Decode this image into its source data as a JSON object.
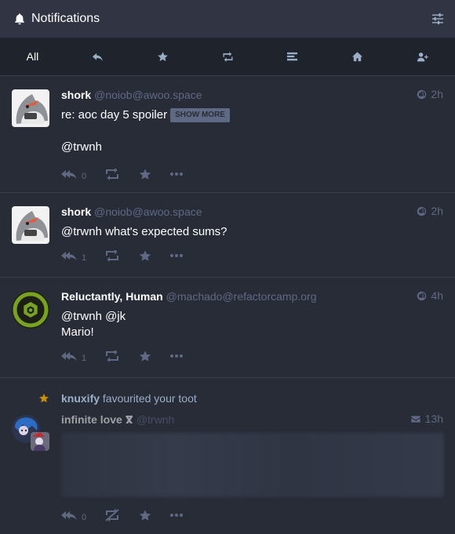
{
  "header": {
    "title": "Notifications",
    "icon": "bell-icon",
    "settings_icon": "sliders-icon"
  },
  "filters": [
    {
      "label": "All",
      "icon": null,
      "active": true
    },
    {
      "label": "",
      "icon": "reply-icon"
    },
    {
      "label": "",
      "icon": "star-icon"
    },
    {
      "label": "",
      "icon": "boost-icon"
    },
    {
      "label": "",
      "icon": "poll-icon"
    },
    {
      "label": "",
      "icon": "home-icon"
    },
    {
      "label": "",
      "icon": "follow-icon"
    }
  ],
  "statuses": [
    {
      "name": "shork",
      "acct": "@noiob@awoo.space",
      "time": "2h",
      "content_line1": "re: aoc day 5 spoiler",
      "show_more": "SHOW MORE",
      "content_line2": "@trwnh",
      "replies": "0"
    },
    {
      "name": "shork",
      "acct": "@noiob@awoo.space",
      "time": "2h",
      "content_line1": "@trwnh what's expected sums?",
      "replies": "1"
    },
    {
      "name": "Reluctantly, Human",
      "acct": "@machado@refactorcamp.org",
      "time": "4h",
      "content_line1": "@trwnh @jk",
      "content_line2": "Mario!",
      "replies": "1"
    }
  ],
  "favourite_notification": {
    "actor": "knuxify",
    "action_text": "favourited your toot",
    "status": {
      "name": "infinite love ⴳ",
      "acct": "@trwnh",
      "time": "13h",
      "replies": "0"
    }
  },
  "colors": {
    "background": "#282c37",
    "header": "#313543",
    "muted": "#606984",
    "secondary": "#9baec8",
    "favourite": "#ca8f04"
  }
}
